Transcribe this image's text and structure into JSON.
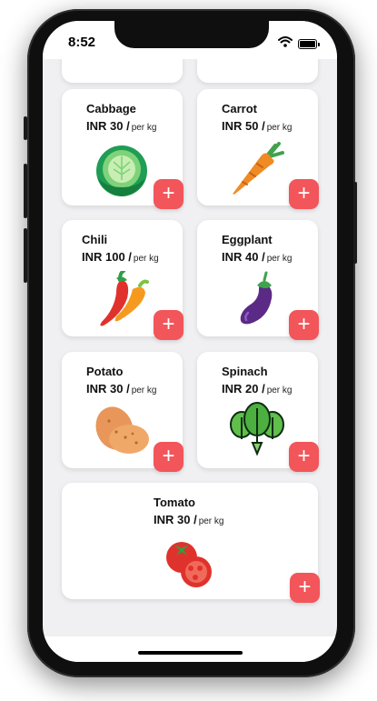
{
  "status": {
    "time": "8:52"
  },
  "add_label": "+",
  "products": [
    {
      "name": "Cabbage",
      "price": "INR 30 /",
      "unit": "per kg"
    },
    {
      "name": "Carrot",
      "price": "INR 50 /",
      "unit": "per kg"
    },
    {
      "name": "Chili",
      "price": "INR 100 /",
      "unit": "per kg"
    },
    {
      "name": "Eggplant",
      "price": "INR 40 /",
      "unit": "per kg"
    },
    {
      "name": "Potato",
      "price": "INR 30 /",
      "unit": "per kg"
    },
    {
      "name": "Spinach",
      "price": "INR 20 /",
      "unit": "per kg"
    },
    {
      "name": "Tomato",
      "price": "INR 30 /",
      "unit": "per kg"
    }
  ]
}
